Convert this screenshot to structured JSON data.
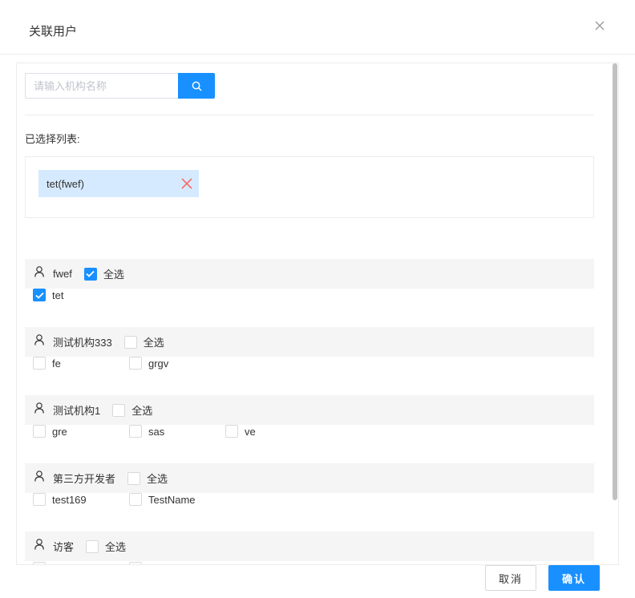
{
  "dialog": {
    "title": "关联用户"
  },
  "search": {
    "placeholder": "请输入机构名称",
    "value": ""
  },
  "selected": {
    "label": "已选择列表:",
    "tags": [
      {
        "text": "tet(fwef)"
      }
    ]
  },
  "groups": [
    {
      "name": "fwef",
      "select_all_label": "全选",
      "select_all_checked": true,
      "members": [
        {
          "name": "tet",
          "checked": true
        }
      ]
    },
    {
      "name": "测试机构333",
      "select_all_label": "全选",
      "select_all_checked": false,
      "members": [
        {
          "name": "fe",
          "checked": false
        },
        {
          "name": "grgv",
          "checked": false
        }
      ]
    },
    {
      "name": "测试机构1",
      "select_all_label": "全选",
      "select_all_checked": false,
      "members": [
        {
          "name": "gre",
          "checked": false
        },
        {
          "name": "sas",
          "checked": false
        },
        {
          "name": "ve",
          "checked": false
        }
      ]
    },
    {
      "name": "第三方开发者",
      "select_all_label": "全选",
      "select_all_checked": false,
      "members": [
        {
          "name": "test169",
          "checked": false
        },
        {
          "name": "TestName",
          "checked": false
        }
      ]
    },
    {
      "name": "访客",
      "select_all_label": "全选",
      "select_all_checked": false,
      "members": []
    }
  ],
  "footer": {
    "cancel_label": "取消",
    "ok_label": "确认"
  },
  "colors": {
    "primary": "#1890ff",
    "tag_bg": "#d6eaff",
    "remove": "#f56c6c",
    "group_bg": "#f5f5f5"
  }
}
